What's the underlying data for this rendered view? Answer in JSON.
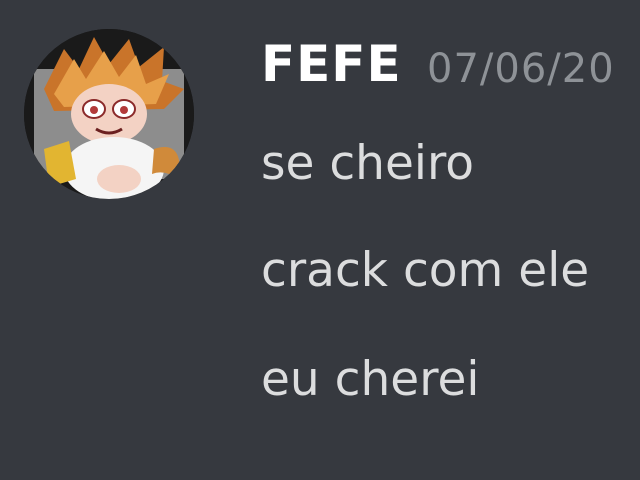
{
  "message": {
    "author": {
      "username": "FEFE",
      "avatar_icon": "anime-character-avatar"
    },
    "timestamp": "07/06/20",
    "lines": [
      "se cheiro",
      "crack com ele",
      "eu cherei"
    ]
  },
  "colors": {
    "background": "#36393f",
    "username": "#ffffff",
    "timestamp": "#8e9297",
    "text": "#dcddde"
  }
}
